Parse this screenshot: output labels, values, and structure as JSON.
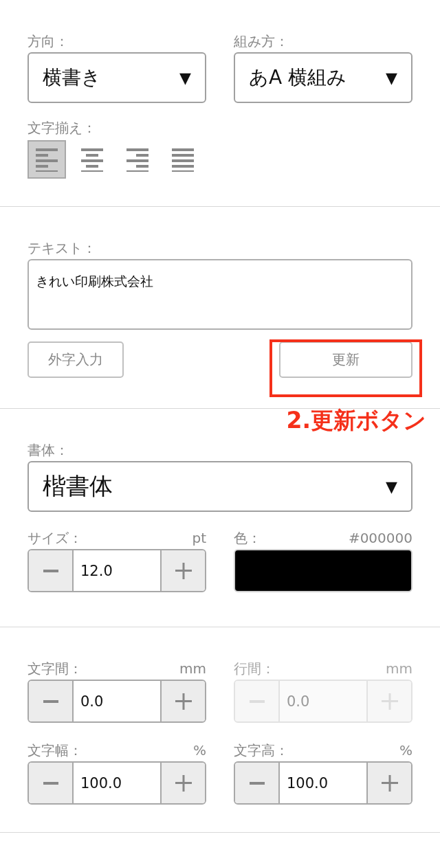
{
  "layout": {
    "direction": {
      "label": "方向：",
      "value": "横書き",
      "arrow": "▼"
    },
    "composition": {
      "label": "組み方：",
      "value": "あA 横組み",
      "arrow": "▼"
    },
    "alignment": {
      "label": "文字揃え：",
      "options": [
        {
          "kind": "left",
          "selected": true
        },
        {
          "kind": "center",
          "selected": false
        },
        {
          "kind": "right",
          "selected": false
        },
        {
          "kind": "justify",
          "selected": false
        }
      ]
    }
  },
  "text": {
    "label": "テキスト：",
    "value": "きれい印刷株式会社",
    "gaiji_button": "外字入力",
    "update_button": "更新",
    "annotation": "2.更新ボタン"
  },
  "font": {
    "label": "書体：",
    "value": "楷書体",
    "arrow": "▼",
    "size": {
      "label": "サイズ：",
      "unit": "pt",
      "value": "12.0",
      "disabled": false
    },
    "color": {
      "label": "色：",
      "code": "#000000",
      "color": "#000000"
    }
  },
  "spacing": [
    {
      "label": "文字間：",
      "unit": "mm",
      "value": "0.0",
      "disabled": false
    },
    {
      "label": "行間：",
      "unit": "mm",
      "value": "0.0",
      "disabled": true
    },
    {
      "label": "文字幅：",
      "unit": "%",
      "value": "100.0",
      "disabled": false
    },
    {
      "label": "文字高：",
      "unit": "%",
      "value": "100.0",
      "disabled": false
    }
  ]
}
